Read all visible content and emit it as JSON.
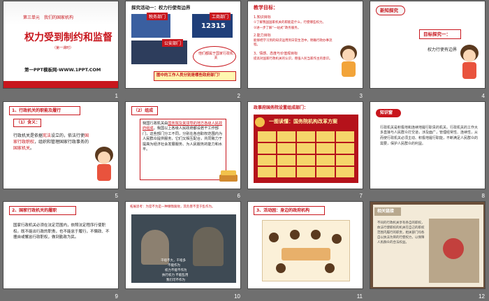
{
  "slides": [
    {
      "number": "1",
      "unit": "第三单元　我们的国家机构",
      "title": "权力受到制约和监督",
      "sub": "（第一课时）",
      "footer": "第一PPT模板网-WWW.1PPT.COM"
    },
    {
      "number": "2",
      "heading": "探究活动一：权力行使有边界",
      "label_tax": "税务部门",
      "label_industry": "工商部门",
      "label_police": "公安部门",
      "label_hotline": "12315",
      "bubble": "他们都属于国家行政机关",
      "caption": "图中的工作人员分别是哪些政府部门？"
    },
    {
      "number": "3",
      "heading": "教学目标：",
      "h1": "1.知识目标",
      "l1": "①了解我国国家机关的职能是什么，行使哪些权力。",
      "l2": "②进一步了解“一站式”政务服务。",
      "h2": "2.能力目标",
      "l3": "能够把学习到的知识运用到日常生活中，明确行政办事流程。",
      "h3": "3、情感、态度与价值观目标",
      "l4": "提高对国家行政机关的认识，增强人民当家作主的意识。"
    },
    {
      "number": "4",
      "heading": "新知探究",
      "box": "目标探究一：",
      "text": "权力行使有边界"
    },
    {
      "number": "5",
      "heading": "1、行政机关的职能及履行",
      "sub": "（1）含义：",
      "body_a": "行政机关是依据",
      "body_b": "宪法",
      "body_c": "设立的，依法行使",
      "body_d": "国家行政职权",
      "body_e": "，组织和管理国家行政事务的",
      "body_f": "国家机关",
      "body_g": "。"
    },
    {
      "number": "6",
      "heading": "（2）组成",
      "body_a": "我国行政机关由",
      "body_b": "国务院及其领导的地方各级人民政府组成",
      "body_c": "。我国以上各级人民政府都设若干工作部门，这些部门分工不同，分别在各自职权范围内为人民群众提供服务，它们又相互配合，共同致力于提高为经济社会发展服务、为人民服务的能力和水平。"
    },
    {
      "number": "7",
      "heading": "政事府国务院设置组成部门：",
      "banner": "一图读懂：国务院机构改革方案"
    },
    {
      "number": "8",
      "heading": "知识窗",
      "body": "行政机关是积极地和连续地履行职责的机关。行政机关的工作大多直接与人民群众打交道，涉及面广，管理经常性、连续性，从而使行政机关必须主动、积极地履行职能，不断满足人民群众的需要，保护人民群众的利益。"
    },
    {
      "number": "9",
      "heading": "2、国家行政机关的履职",
      "body": "国家行政机关必须在法定范围内，依照法定程序行使职权。既不能出行政的职责，也不能怠于履行，不懒政、不擅自或懈怠行政职权，做到勤政为民。"
    },
    {
      "number": "10",
      "heading": "拓展思考：为官不为是一种懒惰腐败，其危害不亚于乱作为。",
      "sub1": "干啥不大，干啥多",
      "sub2": "不能作为",
      "sub3": "权力不能不作为",
      "sub4": "执行权力 不能乱用",
      "sub5": "我们可不作为"
    },
    {
      "number": "11",
      "heading": "3、活动园：身边的政府机构"
    },
    {
      "number": "12",
      "heading": "相关链接",
      "body": "不同的行政机关享有各自的职权，依法行使职权的机关在自己的职权范围内履行的职责，相关部门均各自以执法为目的行使权力，以保障人民群众的合法权益。"
    }
  ]
}
